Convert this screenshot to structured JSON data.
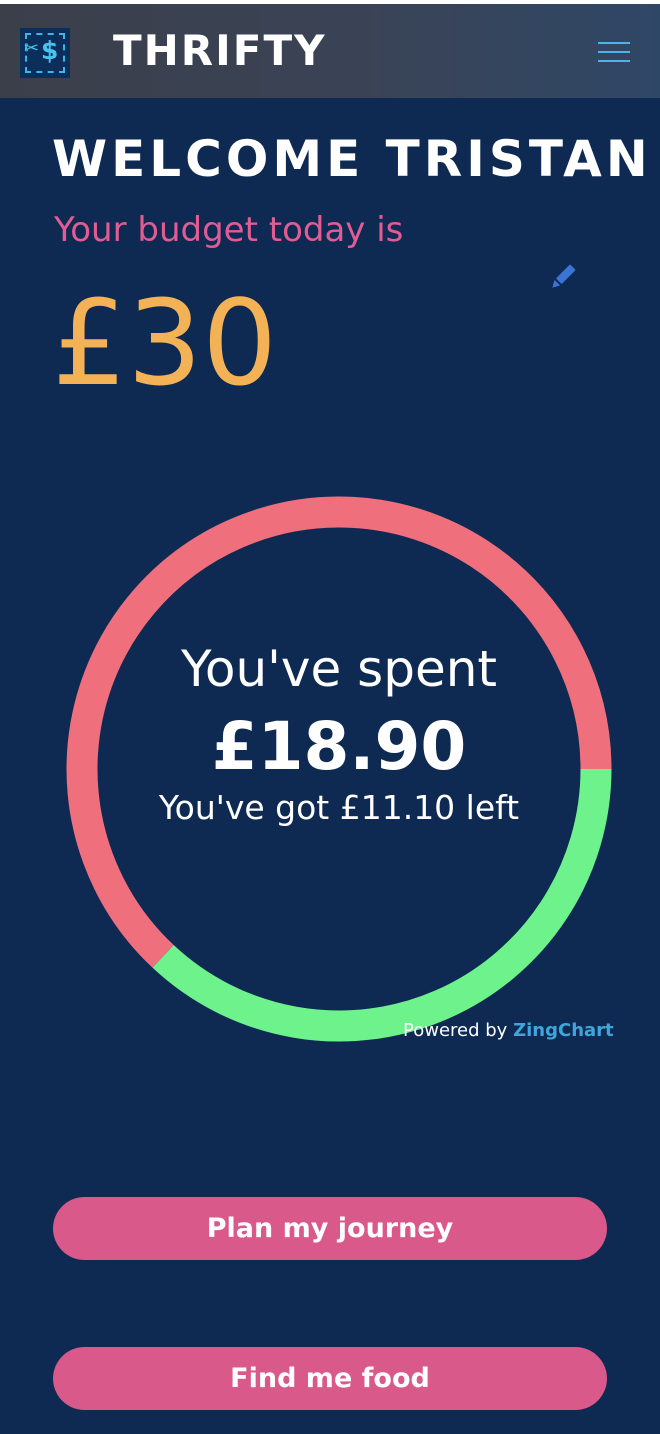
{
  "app": {
    "brand": "THRIFTY",
    "logo_icon": "scissors-dollar-icon",
    "menu_icon": "hamburger-menu-icon"
  },
  "welcome": {
    "heading": "WELCOME TRISTAN",
    "budget_label": "Your budget today is",
    "budget_amount": "£30",
    "edit_icon": "pencil-icon"
  },
  "chart_data": {
    "type": "pie",
    "slices": [
      {
        "name": "spent",
        "value": 18.9,
        "color": "#ef6f7c"
      },
      {
        "name": "left",
        "value": 11.1,
        "color": "#6ef28c"
      }
    ],
    "total": 30,
    "center_label": "You've spent",
    "center_value": "£18.90",
    "center_sub": "You've got £11.10 left",
    "credit": {
      "prefix": "Powered by",
      "name": "ZingChart"
    }
  },
  "actions": {
    "plan_label": "Plan my journey",
    "food_label": "Find me food"
  },
  "colors": {
    "background": "#0e2a52",
    "accent_pink": "#d9598a",
    "budget_label": "#e05c92",
    "amount": "#f4b256",
    "edit": "#3b74d4"
  }
}
